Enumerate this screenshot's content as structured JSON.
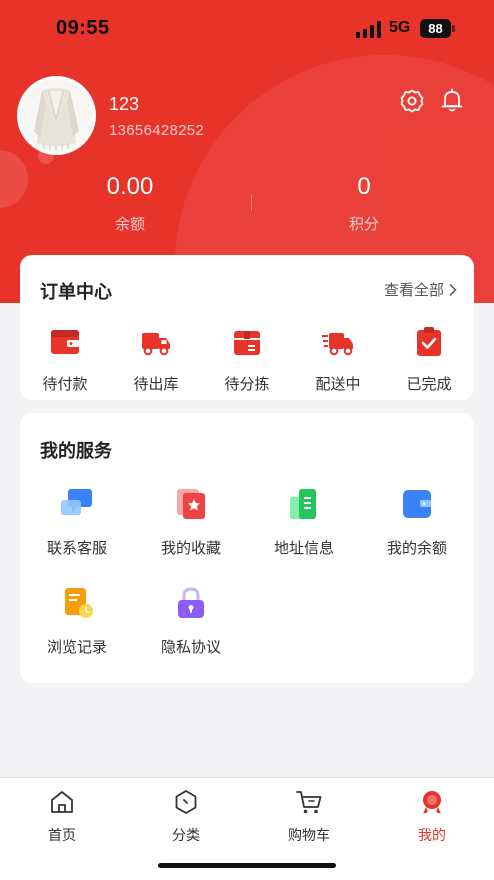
{
  "status_bar": {
    "time": "09:55",
    "network": "5G",
    "battery": "88"
  },
  "profile": {
    "name": "123",
    "phone": "13656428252"
  },
  "stats": [
    {
      "value": "0.00",
      "label": "余额"
    },
    {
      "value": "0",
      "label": "积分"
    }
  ],
  "orders": {
    "title": "订单中心",
    "view_all": "查看全部",
    "items": [
      {
        "label": "待付款",
        "icon": "wallet-icon"
      },
      {
        "label": "待出库",
        "icon": "truck-icon"
      },
      {
        "label": "待分拣",
        "icon": "box-icon"
      },
      {
        "label": "配送中",
        "icon": "fast-truck-icon"
      },
      {
        "label": "已完成",
        "icon": "clipboard-check-icon"
      }
    ]
  },
  "services": {
    "title": "我的服务",
    "items": [
      {
        "label": "联系客服",
        "icon": "chat-icon"
      },
      {
        "label": "我的收藏",
        "icon": "favorite-icon"
      },
      {
        "label": "地址信息",
        "icon": "address-icon"
      },
      {
        "label": "我的余额",
        "icon": "balance-icon"
      },
      {
        "label": "浏览记录",
        "icon": "history-icon"
      },
      {
        "label": "隐私协议",
        "icon": "lock-icon"
      }
    ]
  },
  "tabbar": [
    {
      "label": "首页",
      "icon": "home-icon"
    },
    {
      "label": "分类",
      "icon": "category-icon"
    },
    {
      "label": "购物车",
      "icon": "cart-icon"
    },
    {
      "label": "我的",
      "icon": "profile-icon",
      "active": true
    }
  ],
  "colors": {
    "brand": "#e8332a",
    "background": "#f3f3f5",
    "card": "#ffffff",
    "text": "#222222"
  }
}
